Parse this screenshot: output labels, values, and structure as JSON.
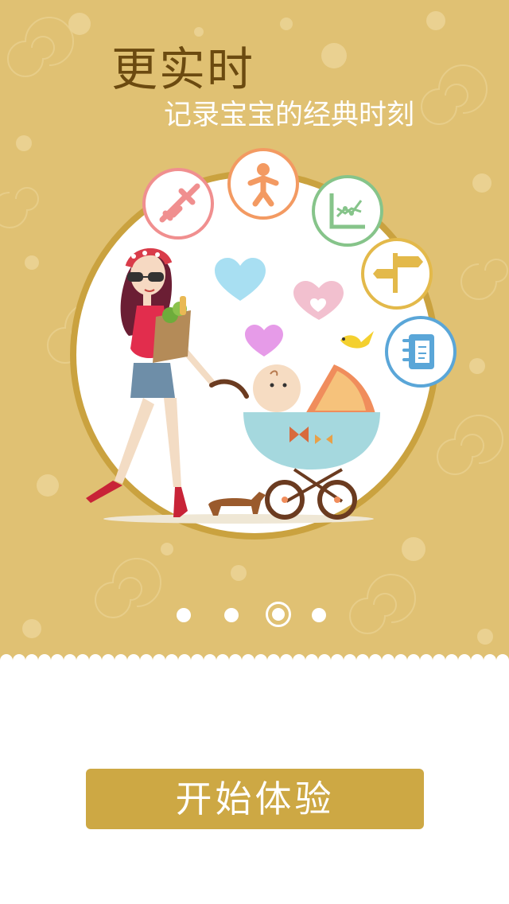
{
  "hero": {
    "title": "更实时",
    "subtitle": "记录宝宝的经典时刻"
  },
  "feature_icons": [
    {
      "name": "vaccine-icon",
      "color": "#f08f8f"
    },
    {
      "name": "growth-person-icon",
      "color": "#f39a62"
    },
    {
      "name": "chart-icon",
      "color": "#86c48a"
    },
    {
      "name": "signpost-icon",
      "color": "#e3b94a"
    },
    {
      "name": "notebook-icon",
      "color": "#5aa6d8"
    }
  ],
  "pager": {
    "pages": 4,
    "current": 3
  },
  "start_button": {
    "label": "开始体验"
  },
  "colors": {
    "hero_background": "#e0c173",
    "title_text": "#6b4a10",
    "button": "#cda844"
  }
}
